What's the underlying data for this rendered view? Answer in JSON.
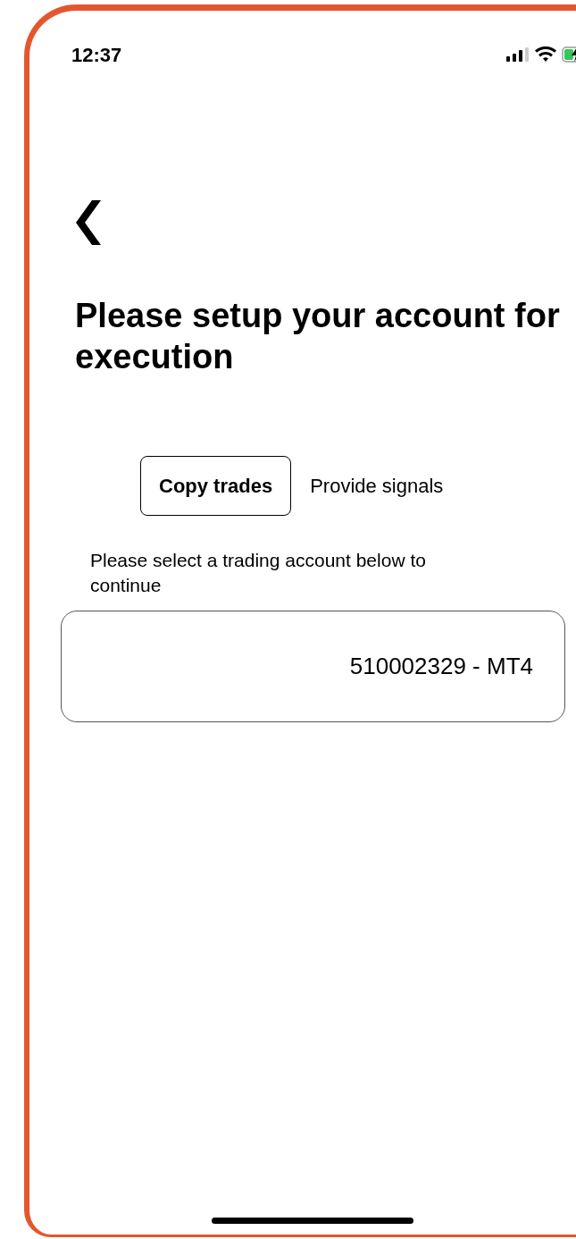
{
  "status_bar": {
    "time": "12:37"
  },
  "title": "Please setup your account for execution",
  "tabs": [
    {
      "label": "Copy trades",
      "selected": true
    },
    {
      "label": "Provide signals",
      "selected": false
    }
  ],
  "instruction": "Please select a trading account below to continue",
  "accounts": [
    {
      "label": "510002329 - MT4"
    }
  ]
}
